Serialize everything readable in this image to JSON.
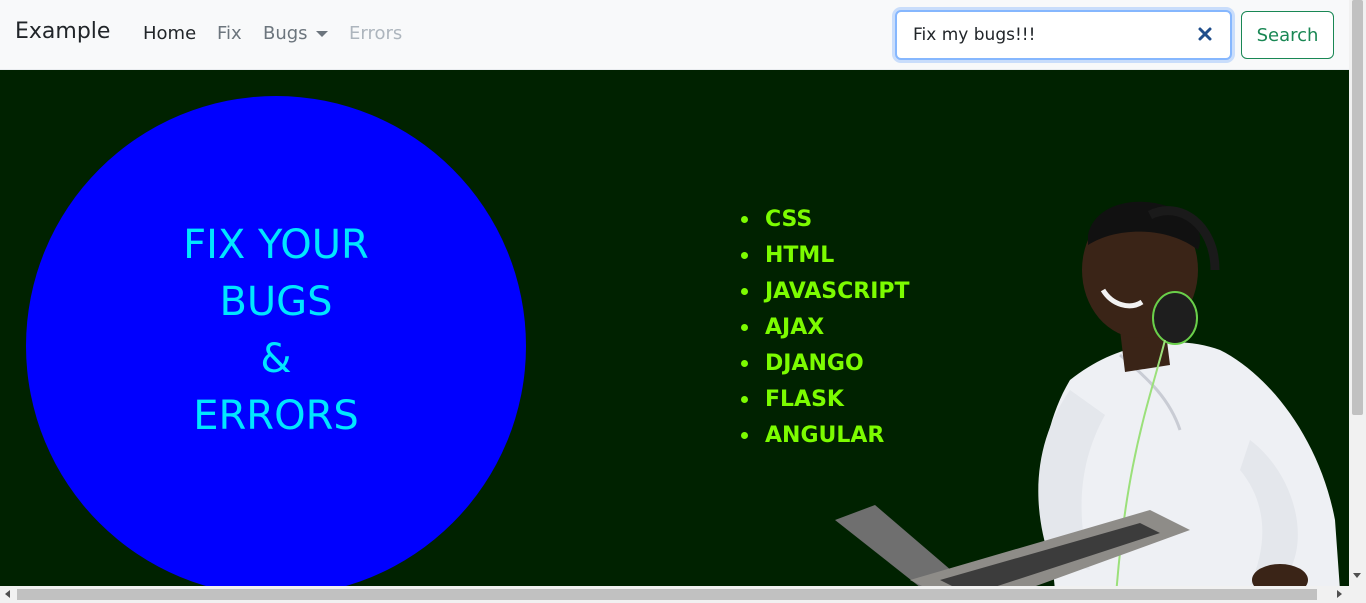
{
  "navbar": {
    "brand": "Example",
    "links": {
      "home": "Home",
      "fix": "Fix",
      "bugs": "Bugs",
      "errors": "Errors"
    },
    "search": {
      "value": "Fix my bugs!!!",
      "button_label": "Search"
    }
  },
  "hero": {
    "circle_lines": [
      "FIX YOUR",
      "BUGS",
      "&",
      "ERRORS"
    ],
    "skills": [
      "CSS",
      "HTML",
      "JAVASCRIPT",
      "AJAX",
      "DJANGO",
      "FLASK",
      "ANGULAR"
    ],
    "colors": {
      "background": "#002200",
      "circle": "#0000ff",
      "circle_text": "#00e6ff",
      "skills_text": "#7cfc00"
    }
  }
}
